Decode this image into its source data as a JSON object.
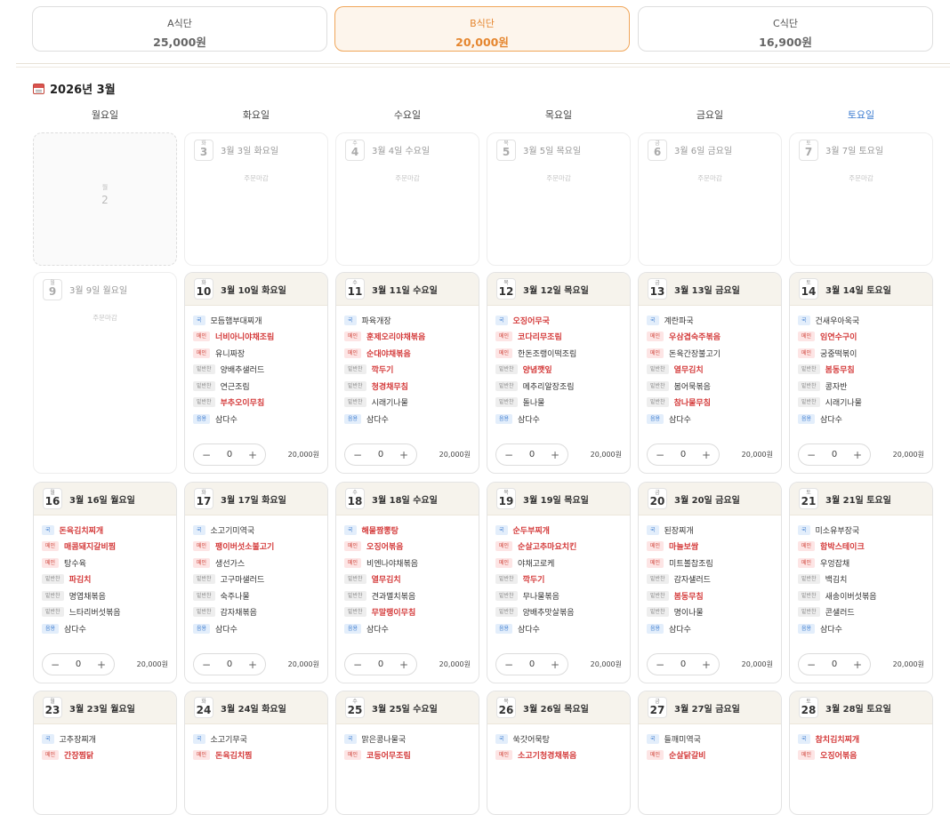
{
  "plans": [
    {
      "name": "A식단",
      "price": "25,000원",
      "active": false
    },
    {
      "name": "B식단",
      "price": "20,000원",
      "active": true
    },
    {
      "name": "C식단",
      "price": "16,900원",
      "active": false
    }
  ],
  "month_title": "2026년 3월",
  "weekdays": [
    "월요일",
    "화요일",
    "수요일",
    "목요일",
    "금요일",
    "토요일"
  ],
  "closed_label": "주문마감",
  "tags": {
    "soup": "국",
    "main": "메인",
    "side": "밑반찬",
    "drink": "음용"
  },
  "weeks": [
    {
      "days": [
        {
          "state": "empty",
          "w": "월",
          "d": "2"
        },
        {
          "state": "off",
          "w": "화",
          "d": "3",
          "label": "3월 3일 화요일"
        },
        {
          "state": "off",
          "w": "수",
          "d": "4",
          "label": "3월 4일 수요일"
        },
        {
          "state": "off",
          "w": "목",
          "d": "5",
          "label": "3월 5일 목요일"
        },
        {
          "state": "off",
          "w": "금",
          "d": "6",
          "label": "3월 6일 금요일"
        },
        {
          "state": "off",
          "w": "토",
          "d": "7",
          "label": "3월 7일 토요일"
        }
      ]
    },
    {
      "days": [
        {
          "state": "off",
          "w": "월",
          "d": "9",
          "label": "3월 9일 월요일"
        },
        {
          "state": "on",
          "w": "화",
          "d": "10",
          "label": "3월 10일 화요일",
          "qty": "0",
          "price": "20,000원",
          "items": [
            {
              "t": "soup",
              "n": "모듬햄부대찌개",
              "hl": false
            },
            {
              "t": "main",
              "n": "너비아니야채조림",
              "hl": true
            },
            {
              "t": "main",
              "n": "유니짜장",
              "hl": false
            },
            {
              "t": "side",
              "n": "양배추샐러드",
              "hl": false
            },
            {
              "t": "side",
              "n": "연근조림",
              "hl": false
            },
            {
              "t": "side",
              "n": "부추오이무침",
              "hl": true
            },
            {
              "t": "drink",
              "n": "삼다수",
              "hl": false
            }
          ]
        },
        {
          "state": "on",
          "w": "수",
          "d": "11",
          "label": "3월 11일 수요일",
          "qty": "0",
          "price": "20,000원",
          "items": [
            {
              "t": "soup",
              "n": "파육개장",
              "hl": false
            },
            {
              "t": "main",
              "n": "훈제오리야채볶음",
              "hl": true
            },
            {
              "t": "main",
              "n": "순대야채볶음",
              "hl": true
            },
            {
              "t": "side",
              "n": "깍두기",
              "hl": true
            },
            {
              "t": "side",
              "n": "청경채무침",
              "hl": true
            },
            {
              "t": "side",
              "n": "시래기나물",
              "hl": false
            },
            {
              "t": "drink",
              "n": "삼다수",
              "hl": false
            }
          ]
        },
        {
          "state": "on",
          "w": "목",
          "d": "12",
          "label": "3월 12일 목요일",
          "qty": "0",
          "price": "20,000원",
          "items": [
            {
              "t": "soup",
              "n": "오징어무국",
              "hl": true
            },
            {
              "t": "main",
              "n": "코다리무조림",
              "hl": true
            },
            {
              "t": "main",
              "n": "한돈조랭이떡조림",
              "hl": false
            },
            {
              "t": "side",
              "n": "양념깻잎",
              "hl": true
            },
            {
              "t": "side",
              "n": "메추리알장조림",
              "hl": false
            },
            {
              "t": "side",
              "n": "돌나물",
              "hl": false
            },
            {
              "t": "drink",
              "n": "삼다수",
              "hl": false
            }
          ]
        },
        {
          "state": "on",
          "w": "금",
          "d": "13",
          "label": "3월 13일 금요일",
          "qty": "0",
          "price": "20,000원",
          "items": [
            {
              "t": "soup",
              "n": "계란파국",
              "hl": false
            },
            {
              "t": "main",
              "n": "우삼겹숙주볶음",
              "hl": true
            },
            {
              "t": "main",
              "n": "돈육간장불고기",
              "hl": false
            },
            {
              "t": "side",
              "n": "열무김치",
              "hl": true
            },
            {
              "t": "side",
              "n": "봄어묵볶음",
              "hl": false
            },
            {
              "t": "side",
              "n": "참나물무침",
              "hl": true
            },
            {
              "t": "drink",
              "n": "삼다수",
              "hl": false
            }
          ]
        },
        {
          "state": "on",
          "w": "토",
          "d": "14",
          "label": "3월 14일 토요일",
          "qty": "0",
          "price": "20,000원",
          "items": [
            {
              "t": "soup",
              "n": "건새우아욱국",
              "hl": false
            },
            {
              "t": "main",
              "n": "임연수구이",
              "hl": true
            },
            {
              "t": "main",
              "n": "궁중떡볶이",
              "hl": false
            },
            {
              "t": "side",
              "n": "봄동무침",
              "hl": true
            },
            {
              "t": "side",
              "n": "콩자반",
              "hl": false
            },
            {
              "t": "side",
              "n": "시래기나물",
              "hl": false
            },
            {
              "t": "drink",
              "n": "삼다수",
              "hl": false
            }
          ]
        }
      ]
    },
    {
      "days": [
        {
          "state": "on",
          "w": "월",
          "d": "16",
          "label": "3월 16일 월요일",
          "qty": "0",
          "price": "20,000원",
          "items": [
            {
              "t": "soup",
              "n": "돈육김치찌개",
              "hl": true
            },
            {
              "t": "main",
              "n": "매콤돼지갈비찜",
              "hl": true
            },
            {
              "t": "main",
              "n": "탕수육",
              "hl": false
            },
            {
              "t": "side",
              "n": "파김치",
              "hl": true
            },
            {
              "t": "side",
              "n": "명엽채볶음",
              "hl": false
            },
            {
              "t": "side",
              "n": "느타리버섯볶음",
              "hl": false
            },
            {
              "t": "drink",
              "n": "삼다수",
              "hl": false
            }
          ]
        },
        {
          "state": "on",
          "w": "화",
          "d": "17",
          "label": "3월 17일 화요일",
          "qty": "0",
          "price": "20,000원",
          "items": [
            {
              "t": "soup",
              "n": "소고기미역국",
              "hl": false
            },
            {
              "t": "main",
              "n": "팽이버섯소불고기",
              "hl": true
            },
            {
              "t": "main",
              "n": "생선가스",
              "hl": false
            },
            {
              "t": "side",
              "n": "고구마샐러드",
              "hl": false
            },
            {
              "t": "side",
              "n": "숙주나물",
              "hl": false
            },
            {
              "t": "side",
              "n": "감자채볶음",
              "hl": false
            },
            {
              "t": "drink",
              "n": "삼다수",
              "hl": false
            }
          ]
        },
        {
          "state": "on",
          "w": "수",
          "d": "18",
          "label": "3월 18일 수요일",
          "qty": "0",
          "price": "20,000원",
          "items": [
            {
              "t": "soup",
              "n": "해물짬뽕탕",
              "hl": true
            },
            {
              "t": "main",
              "n": "오징어볶음",
              "hl": true
            },
            {
              "t": "main",
              "n": "비엔나야채볶음",
              "hl": false
            },
            {
              "t": "side",
              "n": "열무김치",
              "hl": true
            },
            {
              "t": "side",
              "n": "견과멸치볶음",
              "hl": false
            },
            {
              "t": "side",
              "n": "무말랭이무침",
              "hl": true
            },
            {
              "t": "drink",
              "n": "삼다수",
              "hl": false
            }
          ]
        },
        {
          "state": "on",
          "w": "목",
          "d": "19",
          "label": "3월 19일 목요일",
          "qty": "0",
          "price": "20,000원",
          "items": [
            {
              "t": "soup",
              "n": "순두부찌개",
              "hl": true
            },
            {
              "t": "main",
              "n": "순살고추마요치킨",
              "hl": true
            },
            {
              "t": "main",
              "n": "야채고로케",
              "hl": false
            },
            {
              "t": "side",
              "n": "깍두기",
              "hl": true
            },
            {
              "t": "side",
              "n": "무나물볶음",
              "hl": false
            },
            {
              "t": "side",
              "n": "양배추맛살볶음",
              "hl": false
            },
            {
              "t": "drink",
              "n": "삼다수",
              "hl": false
            }
          ]
        },
        {
          "state": "on",
          "w": "금",
          "d": "20",
          "label": "3월 20일 금요일",
          "qty": "0",
          "price": "20,000원",
          "items": [
            {
              "t": "soup",
              "n": "된장찌개",
              "hl": false
            },
            {
              "t": "main",
              "n": "마늘보쌈",
              "hl": true
            },
            {
              "t": "main",
              "n": "미트볼찹조림",
              "hl": false
            },
            {
              "t": "side",
              "n": "감자샐러드",
              "hl": false
            },
            {
              "t": "side",
              "n": "봄동무침",
              "hl": true
            },
            {
              "t": "side",
              "n": "명이나물",
              "hl": false
            },
            {
              "t": "drink",
              "n": "삼다수",
              "hl": false
            }
          ]
        },
        {
          "state": "on",
          "w": "토",
          "d": "21",
          "label": "3월 21일 토요일",
          "qty": "0",
          "price": "20,000원",
          "items": [
            {
              "t": "soup",
              "n": "미소유부장국",
              "hl": false
            },
            {
              "t": "main",
              "n": "함박스테이크",
              "hl": true
            },
            {
              "t": "main",
              "n": "우엉잡채",
              "hl": false
            },
            {
              "t": "side",
              "n": "백김치",
              "hl": false
            },
            {
              "t": "side",
              "n": "새송이버섯볶음",
              "hl": false
            },
            {
              "t": "side",
              "n": "콘샐러드",
              "hl": false
            },
            {
              "t": "drink",
              "n": "삼다수",
              "hl": false
            }
          ]
        }
      ]
    },
    {
      "days": [
        {
          "state": "on",
          "w": "월",
          "d": "23",
          "label": "3월 23일 월요일",
          "qty": "0",
          "price": "20,000원",
          "items": [
            {
              "t": "soup",
              "n": "고추장찌개",
              "hl": false
            },
            {
              "t": "main",
              "n": "간장찜닭",
              "hl": true
            }
          ]
        },
        {
          "state": "on",
          "w": "화",
          "d": "24",
          "label": "3월 24일 화요일",
          "qty": "0",
          "price": "20,000원",
          "items": [
            {
              "t": "soup",
              "n": "소고기무국",
              "hl": false
            },
            {
              "t": "main",
              "n": "돈육김치찜",
              "hl": true
            }
          ]
        },
        {
          "state": "on",
          "w": "수",
          "d": "25",
          "label": "3월 25일 수요일",
          "qty": "0",
          "price": "20,000원",
          "items": [
            {
              "t": "soup",
              "n": "맑은콩나물국",
              "hl": false
            },
            {
              "t": "main",
              "n": "코등어무조림",
              "hl": true
            }
          ]
        },
        {
          "state": "on",
          "w": "목",
          "d": "26",
          "label": "3월 26일 목요일",
          "qty": "0",
          "price": "20,000원",
          "items": [
            {
              "t": "soup",
              "n": "쑥갓어묵탕",
              "hl": false
            },
            {
              "t": "main",
              "n": "소고기청경채볶음",
              "hl": true
            }
          ]
        },
        {
          "state": "on",
          "w": "금",
          "d": "27",
          "label": "3월 27일 금요일",
          "qty": "0",
          "price": "20,000원",
          "items": [
            {
              "t": "soup",
              "n": "들깨미역국",
              "hl": false
            },
            {
              "t": "main",
              "n": "순살닭갈비",
              "hl": true
            }
          ]
        },
        {
          "state": "on",
          "w": "토",
          "d": "28",
          "label": "3월 28일 토요일",
          "qty": "0",
          "price": "20,000원",
          "items": [
            {
              "t": "soup",
              "n": "참치김치찌개",
              "hl": true
            },
            {
              "t": "main",
              "n": "오징어볶음",
              "hl": true
            }
          ]
        }
      ]
    }
  ]
}
